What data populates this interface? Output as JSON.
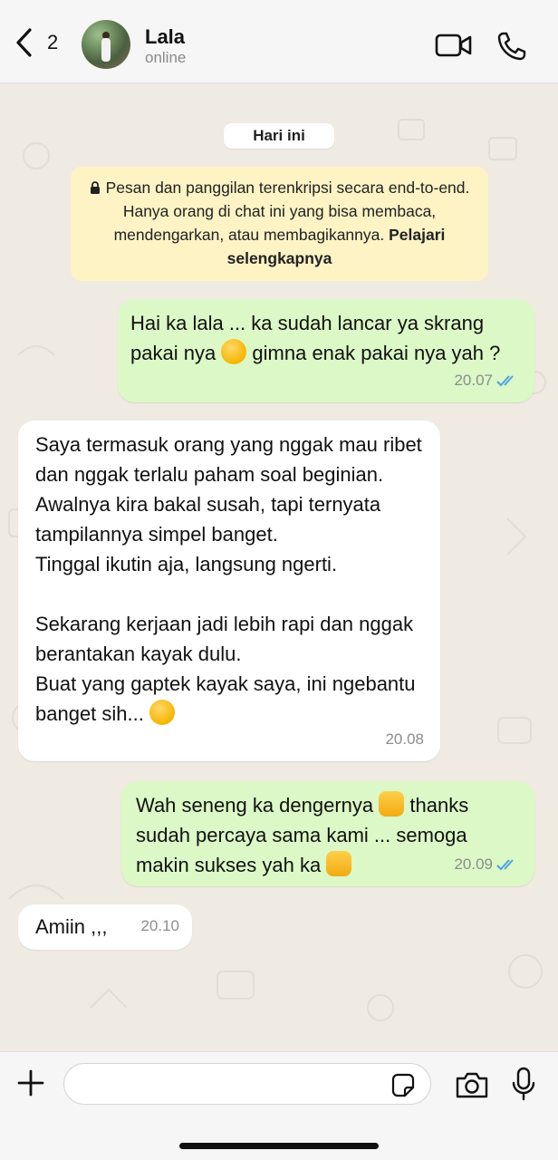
{
  "header": {
    "back_count": "2",
    "contact_name": "Lala",
    "contact_status": "online",
    "icons": [
      "chevron-left-icon",
      "video-camera-icon",
      "phone-icon"
    ]
  },
  "chat": {
    "date_label": "Hari ini",
    "encryption_notice": "Pesan dan panggilan terenkripsi secara end-to-end. Hanya orang di chat ini yang bisa membaca, mendengarkan, atau membagikannya.",
    "encryption_link": "Pelajari selengkapnya",
    "messages": [
      {
        "direction": "outgoing",
        "text_before_emoji": "Hai ka lala ... ka sudah lancar ya skrang pakai nya ",
        "emoji": "star-struck",
        "text_after_emoji": " gimna enak pakai nya yah ?",
        "time": "20.07",
        "read": true
      },
      {
        "direction": "incoming",
        "text": "Saya termasuk orang yang nggak mau ribet dan nggak terlalu paham soal beginian.\nAwalnya kira bakal susah, tapi ternyata tampilannya simpel banget.\nTinggal ikutin aja, langsung ngerti.\n\nSekarang kerjaan jadi lebih rapi dan nggak berantakan kayak dulu.\nBuat yang gaptek kayak saya, ini ngebantu banget sih... ",
        "emoji": "grinning",
        "time": "20.08"
      },
      {
        "direction": "outgoing",
        "text_before_emoji": "Wah seneng ka dengernya ",
        "emoji": "heart-hands",
        "text_middle": " thanks sudah percaya sama kami ... semoga makin sukses yah ka ",
        "emoji2": "palms-up",
        "time": "20.09",
        "read": true
      },
      {
        "direction": "incoming",
        "text": "Amiin ,,,",
        "time": "20.10"
      }
    ]
  },
  "composer": {
    "input_value": "",
    "icons": [
      "plus-icon",
      "sticker-icon",
      "camera-icon",
      "microphone-icon"
    ]
  },
  "colors": {
    "outgoing_bubble": "#dbf8c6",
    "incoming_bubble": "#ffffff",
    "encryption_bg": "#fdf3c5",
    "read_ticks": "#4fa3e0"
  }
}
